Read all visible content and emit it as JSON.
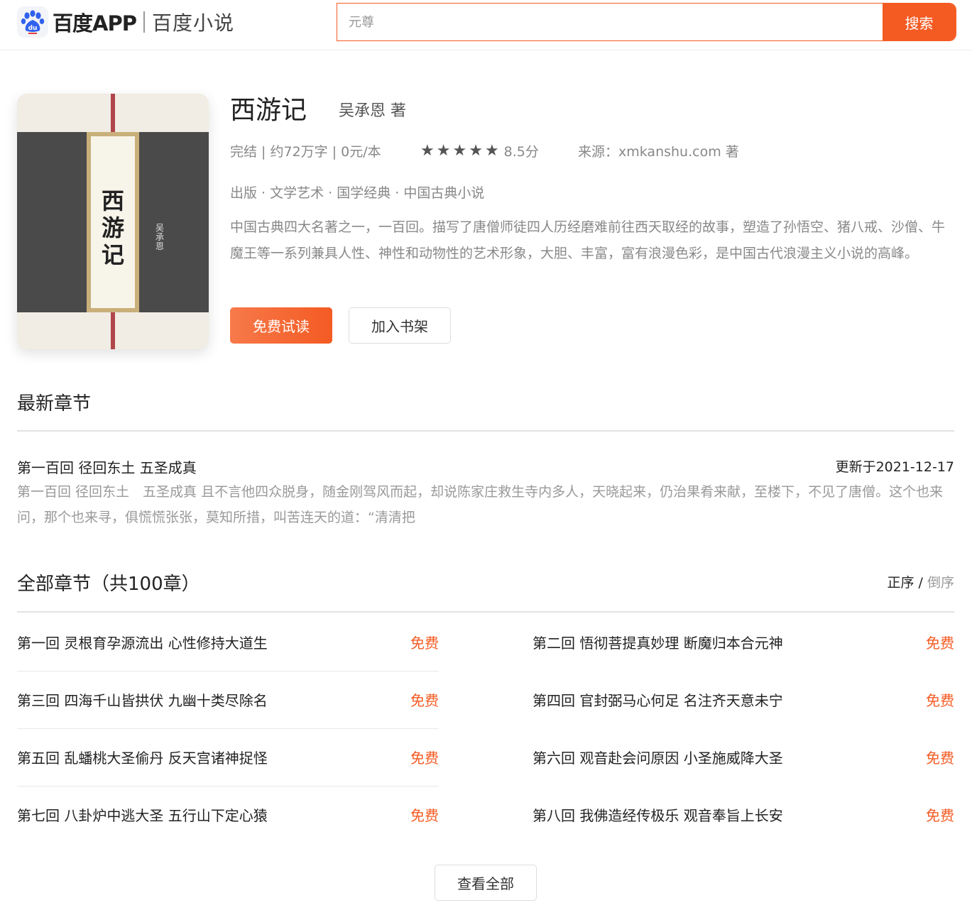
{
  "header": {
    "logo_text": "百度APP",
    "logo_sub": "百度小说",
    "search_placeholder": "元尊",
    "search_button": "搜索"
  },
  "book": {
    "title": "西游记",
    "author": "吴承恩 著",
    "cover_title": "西游记",
    "cover_author": "吴承恩",
    "status": "完结 | 约72万字 | 0元/本",
    "rating": 8.5,
    "rating_max": 5,
    "rating_stars": 5,
    "score_text": "8.5分",
    "source": "来源：xmkanshu.com 著",
    "tags": "出版 · 文学艺术 · 国学经典 · 中国古典小说",
    "description": "中国古典四大名著之一，一百回。描写了唐僧师徒四人历经磨难前往西天取经的故事，塑造了孙悟空、猪八戒、沙僧、牛魔王等一系列兼具人性、神性和动物性的艺术形象，大胆、丰富，富有浪漫色彩，是中国古代浪漫主义小说的高峰。",
    "read_button": "免费试读",
    "shelf_button": "加入书架"
  },
  "latest": {
    "section_title": "最新章节",
    "chapter_title": "第一百回 径回东土 五圣成真",
    "update_date": "更新于2021-12-17",
    "preview": "第一百回 径回东土　五圣成真 且不言他四众脱身，随金刚驾风而起，却说陈家庄救生寺内多人，天晓起来，仍治果肴来献，至楼下，不见了唐僧。这个也来问，那个也来寻，俱慌慌张张，莫知所措，叫苦连天的道：“清清把"
  },
  "chapters": {
    "section_title": "全部章节（共100章）",
    "order_asc": "正序",
    "order_sep": " / ",
    "order_desc": "倒序",
    "items": [
      {
        "title": "第一回 灵根育孕源流出 心性修持大道生",
        "tag": "免费"
      },
      {
        "title": "第二回 悟彻菩提真妙理 断魔归本合元神",
        "tag": "免费"
      },
      {
        "title": "第三回 四海千山皆拱伏 九幽十类尽除名",
        "tag": "免费"
      },
      {
        "title": "第四回 官封弼马心何足 名注齐天意未宁",
        "tag": "免费"
      },
      {
        "title": "第五回 乱蟠桃大圣偷丹 反天宫诸神捉怪",
        "tag": "免费"
      },
      {
        "title": "第六回 观音赴会问原因 小圣施威降大圣",
        "tag": "免费"
      },
      {
        "title": "第七回 八卦炉中逃大圣 五行山下定心猿",
        "tag": "免费"
      },
      {
        "title": "第八回 我佛造经传极乐 观音奉旨上长安",
        "tag": "免费"
      }
    ],
    "view_all": "查看全部"
  },
  "colors": {
    "accent": "#f45b23",
    "text_primary": "#222222",
    "text_secondary": "#888888",
    "divider": "#e2e2e2"
  }
}
